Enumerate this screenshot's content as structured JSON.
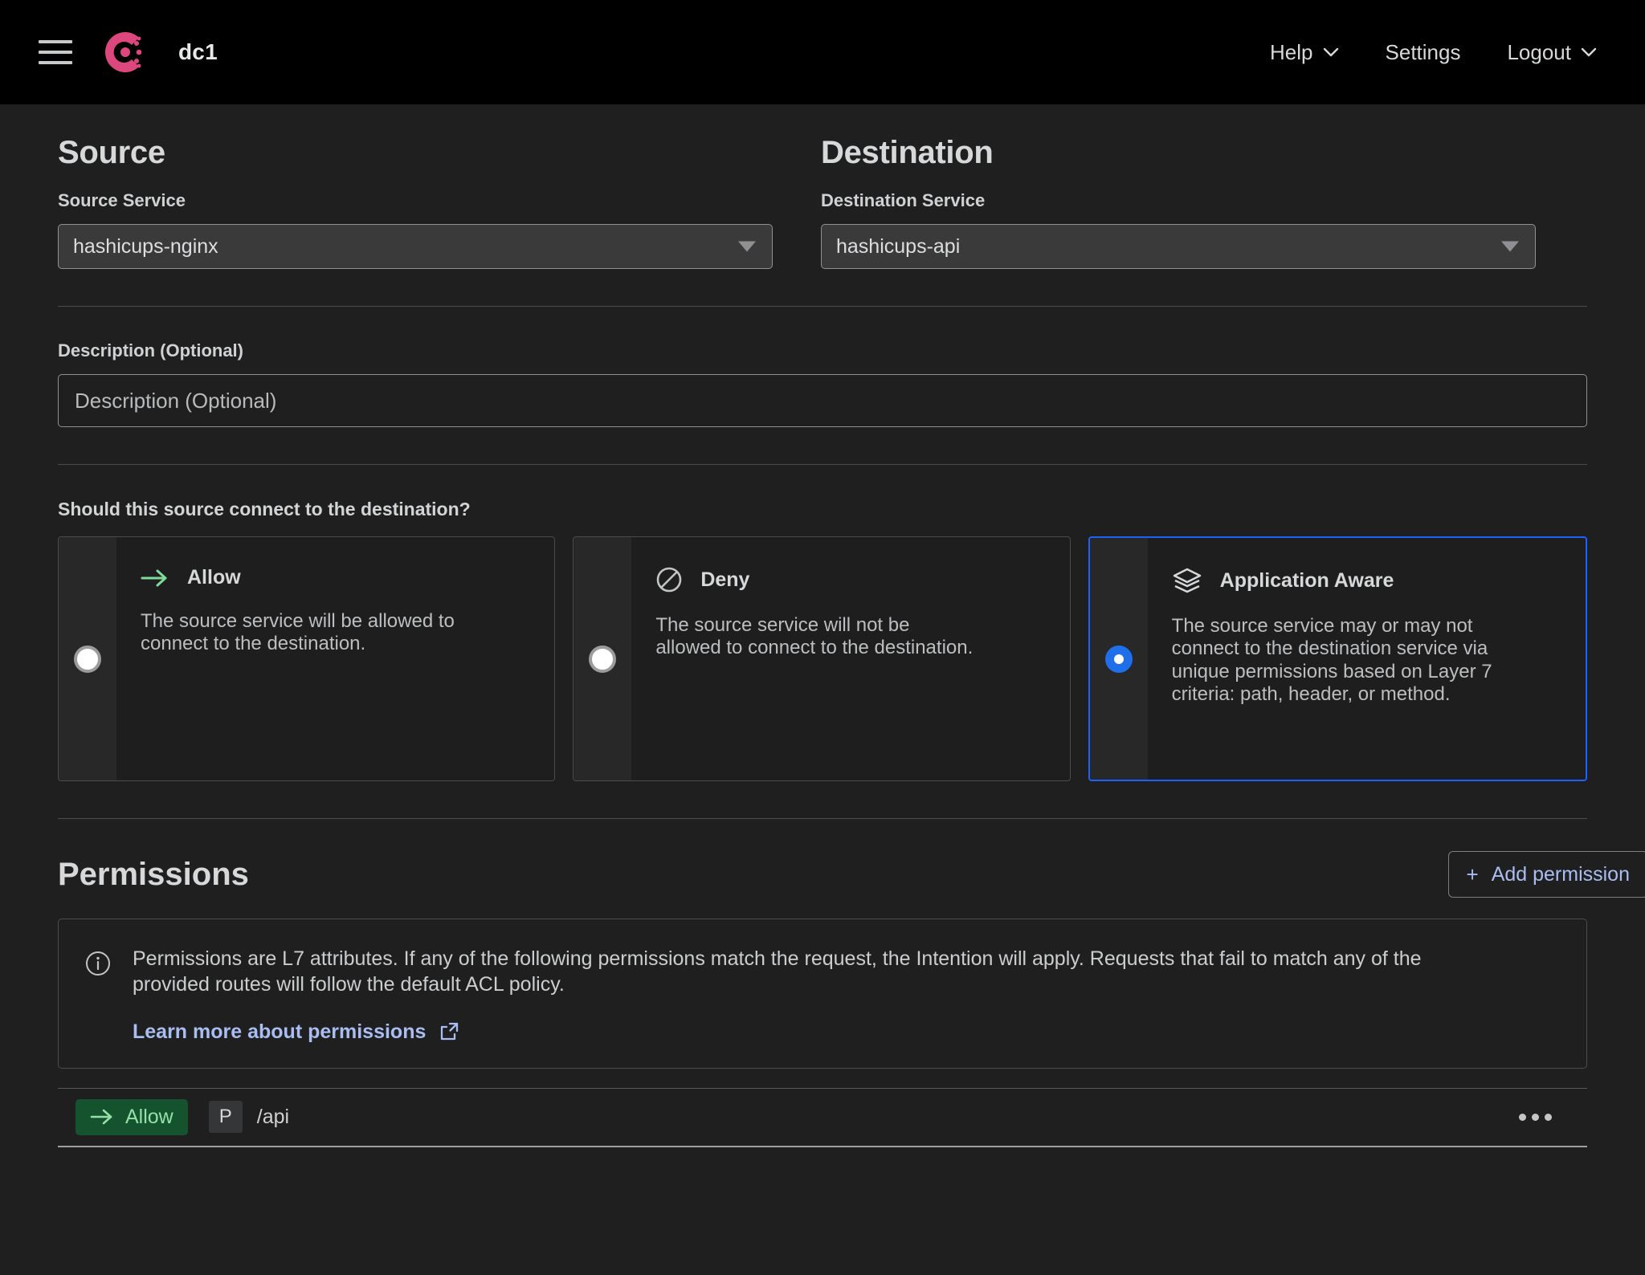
{
  "header": {
    "menu_icon": "hamburger-menu-icon",
    "logo_icon": "consul-logo-icon",
    "datacenter": "dc1",
    "nav": [
      {
        "label": "Help",
        "has_chevron": true
      },
      {
        "label": "Settings",
        "has_chevron": false
      },
      {
        "label": "Logout",
        "has_chevron": true
      }
    ]
  },
  "source": {
    "heading": "Source",
    "field_label": "Source Service",
    "selected": "hashicups-nginx"
  },
  "destination": {
    "heading": "Destination",
    "field_label": "Destination Service",
    "selected": "hashicups-api"
  },
  "description": {
    "label": "Description (Optional)",
    "value": "",
    "placeholder": "Description (Optional)"
  },
  "connect_question": {
    "label": "Should this source connect to the destination?",
    "options": [
      {
        "title": "Allow",
        "icon": "arrow-right-icon",
        "description": "The source service will be allowed to connect to the destination.",
        "selected": false
      },
      {
        "title": "Deny",
        "icon": "no-entry-icon",
        "description": "The source service will not be allowed to connect to the destination.",
        "selected": false
      },
      {
        "title": "Application Aware",
        "icon": "layers-icon",
        "description": "The source service may or may not connect to the destination service via unique permissions based on Layer 7 criteria: path, header, or method.",
        "selected": true
      }
    ]
  },
  "permissions": {
    "heading": "Permissions",
    "add_button": "Add permission",
    "add_button_icon": "plus-icon",
    "notice": {
      "icon": "info-circle-icon",
      "text": "Permissions are L7 attributes. If any of the following permissions match the request, the Intention will apply. Requests that fail to match any of the provided routes will follow the default ACL policy.",
      "link_text": "Learn more about permissions",
      "link_icon": "external-link-icon"
    },
    "rows": [
      {
        "action": "Allow",
        "action_icon": "arrow-right-icon",
        "method_chip": "P",
        "path": "/api",
        "menu_icon": "more-horizontal-icon"
      }
    ]
  },
  "colors": {
    "accent_blue": "#1f6feb",
    "link_blue": "#a9bdf2",
    "allow_green": "#94e0a8",
    "allow_green_bg": "#14532d",
    "brand_pink": "#dc477d",
    "header_bg": "#000000",
    "page_bg": "#1f1f1f"
  }
}
